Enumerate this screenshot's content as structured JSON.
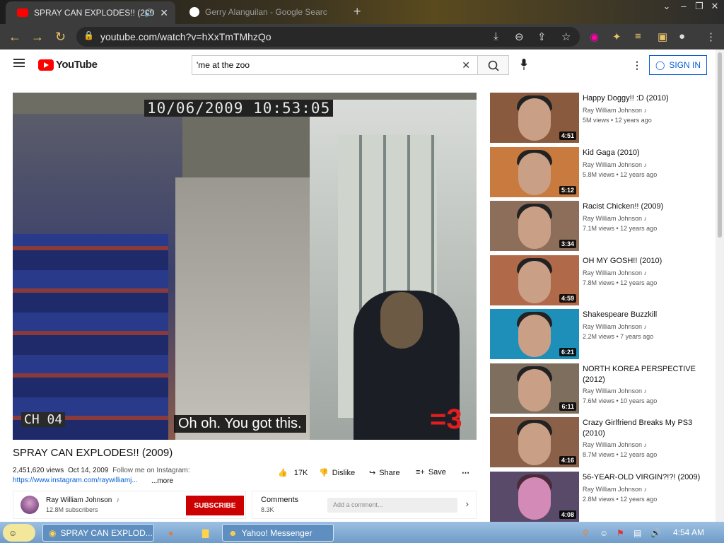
{
  "browser": {
    "tabs": [
      {
        "title": "SPRAY CAN EXPLODES!! (200"
      },
      {
        "title": "Gerry Alanguilan - Google Searc"
      }
    ],
    "url": "youtube.com/watch?v=hXxTmTMhzQo"
  },
  "youtube": {
    "logo_text": "YouTube",
    "search_value": "'me at the zoo",
    "sign_in": "SIGN IN"
  },
  "video": {
    "timestamp_overlay": "10/06/2009  10:53:05",
    "channel_overlay": "CH 04",
    "caption": "Oh oh. You got this.",
    "watermark": "=3",
    "title": "SPRAY CAN EXPLODES!! (2009)",
    "views": "2,451,620 views",
    "date": "Oct 14, 2009",
    "desc": "Follow me on Instagram:",
    "link": "https://www.instagram.com/raywilliamj...",
    "more": "...more",
    "likes": "17K",
    "dislike": "Dislike",
    "share": "Share",
    "save": "Save"
  },
  "channel": {
    "name": "Ray William Johnson",
    "note_icon": "♪",
    "subs": "12.8M subscribers",
    "subscribe": "SUBSCRIBE"
  },
  "comments": {
    "title": "Comments",
    "count": "8.3K",
    "placeholder": "Add a comment..."
  },
  "recommendations": [
    {
      "title": "Happy Doggy!! :D (2010)",
      "channel": "Ray William Johnson",
      "meta": "5M views • 12 years ago",
      "duration": "4:51"
    },
    {
      "title": "Kid Gaga (2010)",
      "channel": "Ray William Johnson",
      "meta": "5.8M views • 12 years ago",
      "duration": "5:12"
    },
    {
      "title": "Racist Chicken!! (2009)",
      "channel": "Ray William Johnson",
      "meta": "7.1M views • 12 years ago",
      "duration": "3:34"
    },
    {
      "title": "OH MY GOSH!! (2010)",
      "channel": "Ray William Johnson",
      "meta": "7.8M views • 12 years ago",
      "duration": "4:59"
    },
    {
      "title": "Shakespeare Buzzkill",
      "channel": "Ray William Johnson",
      "meta": "2.2M views • 7 years ago",
      "duration": "6:21"
    },
    {
      "title": "NORTH KOREA PERSPECTIVE (2012)",
      "channel": "Ray William Johnson",
      "meta": "7.6M views • 10 years ago",
      "duration": "6:11"
    },
    {
      "title": "Crazy Girlfriend Breaks My PS3 (2010)",
      "channel": "Ray William Johnson",
      "meta": "8.7M views • 12 years ago",
      "duration": "4:16"
    },
    {
      "title": "56-YEAR-OLD VIRGIN?!?! (2009)",
      "channel": "Ray William Johnson",
      "meta": "2.8M views • 12 years ago",
      "duration": "4:08"
    }
  ],
  "taskbar": {
    "items": [
      "SPRAY CAN EXPLOD...",
      "Yahoo! Messenger"
    ],
    "clock": "4:54 AM"
  },
  "colors": {
    "accent": "#065fd4",
    "subscribe": "#cc0000",
    "youtube_red": "#ff0000"
  }
}
